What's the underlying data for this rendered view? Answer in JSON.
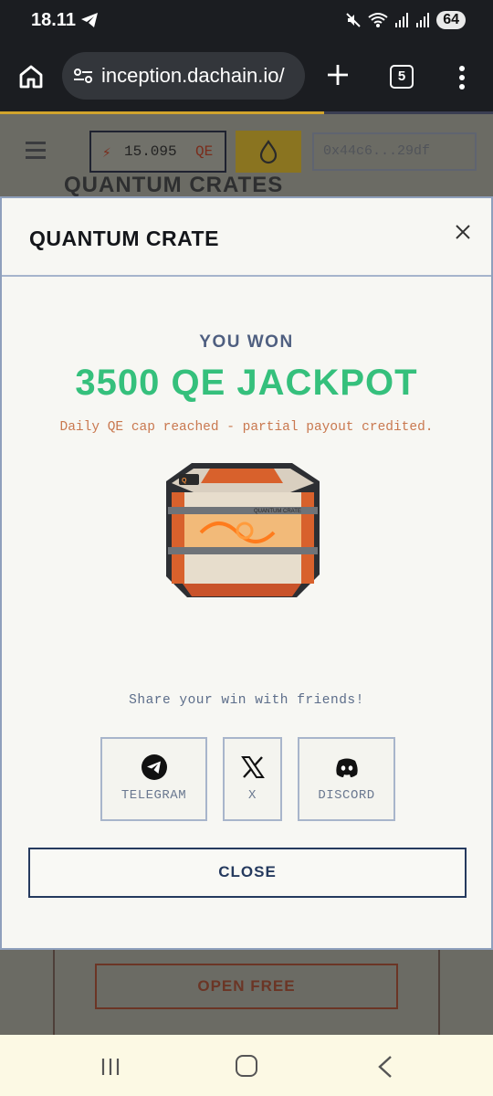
{
  "status_bar": {
    "time": "18.11",
    "battery": "64",
    "icons": [
      "telegram-icon",
      "mute-icon",
      "wifi-icon",
      "signal-icon",
      "signal-icon",
      "battery-icon"
    ]
  },
  "browser": {
    "url": "inception.dachain.io/",
    "tab_count": "5"
  },
  "page_behind": {
    "qe_balance": "15.095",
    "qe_unit": "QE",
    "wallet": "0x44c6...29df",
    "section_title": "QUANTUM CRATES",
    "open_free_label": "OPEN FREE"
  },
  "modal": {
    "title": "QUANTUM CRATE",
    "you_won": "YOU WON",
    "prize": "3500 QE JACKPOT",
    "notice": "Daily QE cap reached - partial payout credited.",
    "crate_label": "QUANTUM CRATE",
    "share_prompt": "Share your win with friends!",
    "share_buttons": [
      {
        "label": "TELEGRAM",
        "icon": "telegram-icon"
      },
      {
        "label": "X",
        "icon": "x-logo-icon"
      },
      {
        "label": "DISCORD",
        "icon": "discord-icon"
      }
    ],
    "close_label": "CLOSE"
  },
  "colors": {
    "prize_green": "#35c07c",
    "accent_navy": "#253a5e",
    "notice_orange": "#c9784f"
  }
}
